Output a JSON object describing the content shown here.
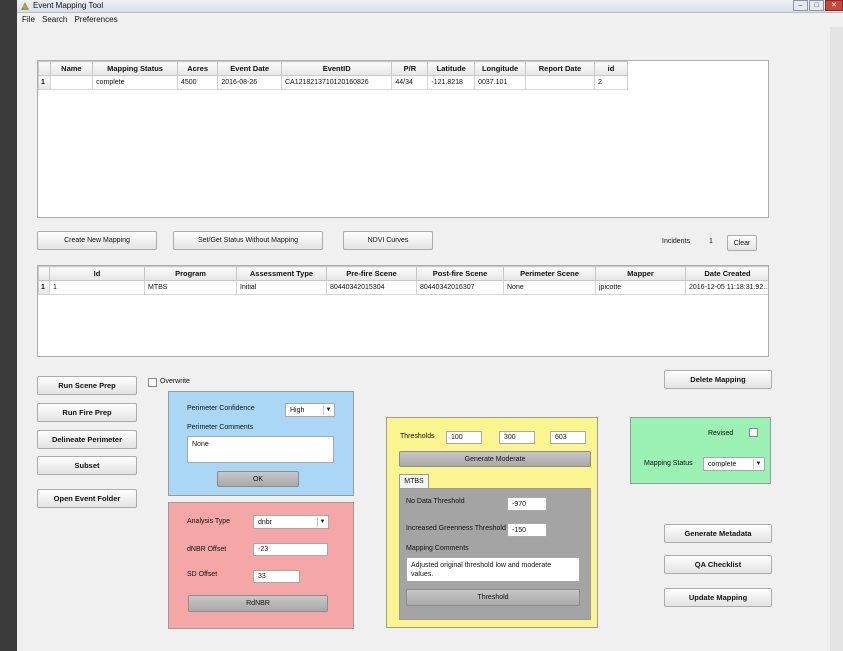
{
  "window": {
    "title": "Event Mapping Tool",
    "controls": [
      "–",
      "□",
      "✕"
    ]
  },
  "menu": [
    "File",
    "Search",
    "Preferences"
  ],
  "events_table": {
    "headers": [
      "Name",
      "Mapping Status",
      "Acres",
      "Event Date",
      "EventID",
      "P/R",
      "Latitude",
      "Longitude",
      "Report Date",
      "id"
    ],
    "rows": [
      {
        "num": "1",
        "cells": [
          "",
          "complete",
          "4500",
          "2016-08-26",
          "CA1218213710120160826",
          "44/34",
          "-121.8218",
          "0037.101",
          "",
          "2"
        ]
      }
    ]
  },
  "mid_buttons": {
    "create": "Create New Mapping",
    "setget": "Set/Get Status Without Mapping",
    "ndvi": "NDVI Curves",
    "incidents_label": "Incidents",
    "incidents_count": "1",
    "clear": "Clear"
  },
  "mappings_table": {
    "headers": [
      "Id",
      "Program",
      "Assessment Type",
      "Pre-fire Scene",
      "Post-fire Scene",
      "Perimeter Scene",
      "Mapper",
      "Date Created"
    ],
    "rows": [
      {
        "num": "1",
        "cells": [
          "1",
          "MTBS",
          "Initial",
          "80440342015304",
          "80440342016307",
          "None",
          "jpicotte",
          "2016-12-05 11:18:31.92..."
        ]
      }
    ]
  },
  "left_buttons": [
    "Run Scene Prep",
    "Run Fire Prep",
    "Delineate Perimeter",
    "Subset",
    "Open Event Folder"
  ],
  "overwrite_label": "Overwrite",
  "perimeter_panel": {
    "confidence_label": "Perimeter Confidence",
    "confidence_value": "High",
    "comments_label": "Perimeter Comments",
    "comments_value": "None",
    "ok": "OK",
    "bg": "#a9d7f5"
  },
  "analysis_panel": {
    "type_label": "Analysis Type",
    "type_value": "dnbr",
    "dnbr_offset_label": "dNBR Offset",
    "dnbr_offset_value": "-23",
    "sd_offset_label": "SD Offset",
    "sd_offset_value": "33",
    "rdnbr": "RdNBR",
    "bg": "#f5a6a6"
  },
  "threshold_panel": {
    "thresholds_label": "Thresholds",
    "t1": "100",
    "t2": "300",
    "t3": "603",
    "generate": "Generate Moderate",
    "tab": "MTBS",
    "nodata_label": "No Data Threshold",
    "nodata_value": "-970",
    "greenness_label": "Increased Greenness Threshold",
    "greenness_value": "-150",
    "comments_label": "Mapping Comments",
    "comments_value": "Adjusted original threshold low and moderate values.",
    "threshold_btn": "Threshold",
    "bg": "#fbf58f"
  },
  "status_panel": {
    "revised_label": "Revised",
    "status_label": "Mapping Status",
    "status_value": "complete",
    "bg": "#9bf0b4"
  },
  "right_buttons": {
    "delete": "Delete Mapping",
    "metadata": "Generate Metadata",
    "qa": "QA Checklist",
    "update": "Update Mapping"
  }
}
